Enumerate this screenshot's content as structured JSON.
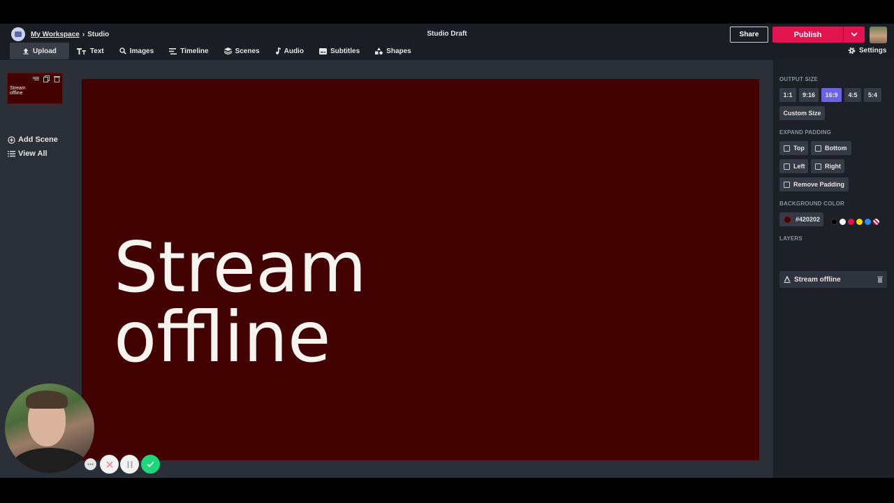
{
  "header": {
    "workspace": "My Workspace",
    "separator": "›",
    "section": "Studio",
    "title": "Studio Draft",
    "share_label": "Share",
    "publish_label": "Publish"
  },
  "toolbar": {
    "items": [
      {
        "label": "Upload",
        "icon": "upload-icon"
      },
      {
        "label": "Text",
        "icon": "text-icon"
      },
      {
        "label": "Images",
        "icon": "search-icon"
      },
      {
        "label": "Timeline",
        "icon": "timeline-icon"
      },
      {
        "label": "Scenes",
        "icon": "layers-icon"
      },
      {
        "label": "Audio",
        "icon": "music-note-icon"
      },
      {
        "label": "Subtitles",
        "icon": "subtitles-icon"
      },
      {
        "label": "Shapes",
        "icon": "shapes-icon"
      }
    ],
    "settings_label": "Settings"
  },
  "scenes": {
    "thumb_text": "Stream offline",
    "add_label": "Add Scene",
    "view_label": "View All"
  },
  "canvas": {
    "background": "#420202",
    "line1": "Stream",
    "line2": "offline"
  },
  "right_panel": {
    "output_size_label": "OUTPUT SIZE",
    "sizes": [
      "1:1",
      "9:16",
      "16:9",
      "4:5",
      "5:4"
    ],
    "selected_size": "16:9",
    "custom_size_label": "Custom Size",
    "expand_padding_label": "EXPAND PADDING",
    "padding": {
      "top": "Top",
      "bottom": "Bottom",
      "left": "Left",
      "right": "Right",
      "remove": "Remove Padding"
    },
    "background_color_label": "BACKGROUND COLOR",
    "background_color_value": "#420202",
    "swatch_colors": [
      "#000000",
      "#ffffff",
      "#e0144e",
      "#f5d90a",
      "#2f8ff0",
      "striped"
    ],
    "layers_label": "LAYERS",
    "layer_name": "Stream offline"
  },
  "colors": {
    "accent": "#6b63e6",
    "publish": "#e0144e",
    "confirm": "#1fd67a"
  }
}
